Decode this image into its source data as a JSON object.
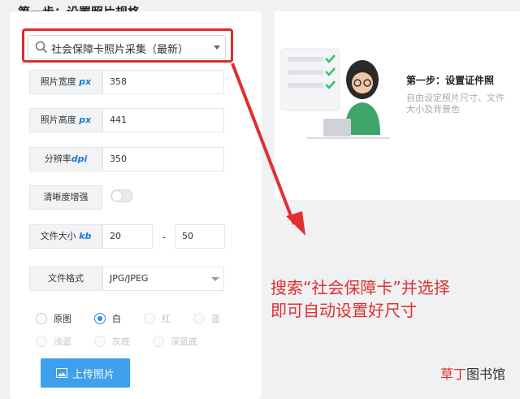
{
  "left": {
    "step_title": "第一步：设置照片规格",
    "search_value": "社会保障卡照片采集（最新）",
    "fields": {
      "width_label": "照片宽度",
      "width_unit": "px",
      "width_value": "358",
      "height_label": "照片高度",
      "height_unit": "px",
      "height_value": "441",
      "dpi_label": "分辨率",
      "dpi_unit": "dpi",
      "dpi_value": "350",
      "sharpen_label": "清晰度增强",
      "size_label": "文件大小",
      "size_unit": "kb",
      "size_min": "20",
      "size_dash": "-",
      "size_max": "50",
      "format_label": "文件格式",
      "format_value": "JPG/JPEG"
    },
    "background_options": [
      "原图",
      "白",
      "红",
      "蓝",
      "浅蓝",
      "灰底",
      "深蓝底"
    ],
    "selected_background": "白",
    "upload_label": "上传照片"
  },
  "right": {
    "card_title": "第一步：设置证件照",
    "card_desc": "自由设定照片尺寸、文件大小及背景色"
  },
  "annotation": {
    "line1": "搜索“社会保障卡”并选择",
    "line2": "即可自动设置好尺寸"
  },
  "watermark": {
    "part1": "草丁",
    "part2": "图书馆"
  },
  "colors": {
    "accent": "#3ea0ec",
    "highlight": "#e02b2b",
    "selected": "#2c8be8"
  }
}
